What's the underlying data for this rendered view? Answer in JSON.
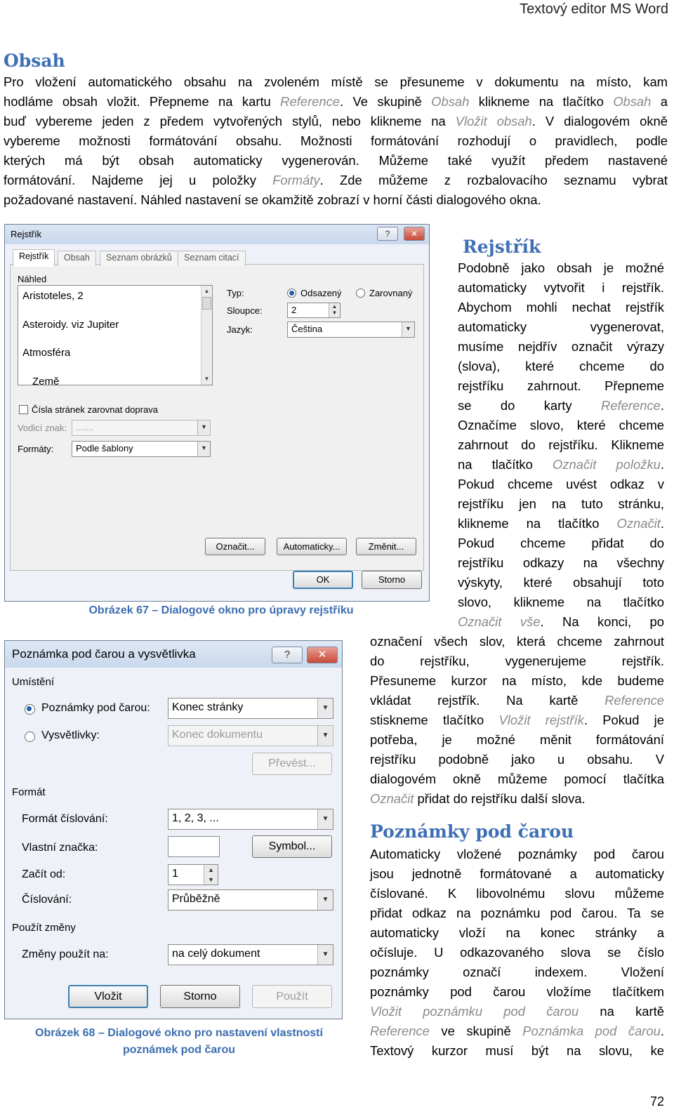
{
  "header": "Textový editor MS Word",
  "page_number": "72",
  "obsah": {
    "heading": "Obsah",
    "lines": [
      [
        {
          "t": "Pro vložení automatického obsahu na zvoleném místě se přesuneme v dokumentu na místo, kam"
        }
      ],
      [
        {
          "t": "hodláme obsah vložit. Přepneme na kartu "
        },
        {
          "t": "Reference",
          "hl": true
        },
        {
          "t": ". Ve skupině "
        },
        {
          "t": "Obsah",
          "hl": true
        },
        {
          "t": " klikneme na tlačítko "
        },
        {
          "t": "Obsah",
          "hl": true
        },
        {
          "t": " a"
        }
      ],
      [
        {
          "t": "buď vybereme jeden z předem vytvořených stylů, nebo klikneme na "
        },
        {
          "t": "Vložit obsah",
          "hl": true
        },
        {
          "t": ". V dialogovém okně"
        }
      ],
      [
        {
          "t": "vybereme možnosti formátování obsahu. Možnosti formátování rozhodují o pravidlech, podle"
        }
      ],
      [
        {
          "t": "kterých má být obsah automaticky vygenerován. Můžeme také využít předem nastavené"
        }
      ],
      [
        {
          "t": "formátování. Najdeme jej u položky "
        },
        {
          "t": "Formáty",
          "hl": true
        },
        {
          "t": ". Zde můžeme z rozbalovacího seznamu vybrat"
        }
      ],
      [
        {
          "t": "požadované nastavení. Náhled nastavení se okamžitě zobrazí v horní části dialogového okna."
        }
      ]
    ]
  },
  "rejstrik": {
    "heading": "Rejstřík",
    "narrow_lines": [
      [
        {
          "t": "Podobně jako obsah je možné"
        }
      ],
      [
        {
          "t": "automaticky vytvořit i rejstřík."
        }
      ],
      [
        {
          "t": "Abychom mohli nechat rejstřík"
        }
      ],
      [
        {
          "t": "automaticky vygenerovat,"
        }
      ],
      [
        {
          "t": "musíme nejdřív označit výrazy"
        }
      ],
      [
        {
          "t": "(slova), které chceme do"
        }
      ],
      [
        {
          "t": "rejstříku zahrnout. Přepneme"
        }
      ],
      [
        {
          "t": "se do karty "
        },
        {
          "t": "Reference",
          "hl": true
        },
        {
          "t": "."
        }
      ],
      [
        {
          "t": "Označíme slovo, které chceme"
        }
      ],
      [
        {
          "t": "zahrnout do rejstříku. Klikneme"
        }
      ],
      [
        {
          "t": "na tlačítko "
        },
        {
          "t": "Označit položku",
          "hl": true
        },
        {
          "t": "."
        }
      ],
      [
        {
          "t": "Pokud chceme uvést odkaz v"
        }
      ],
      [
        {
          "t": "rejstříku jen na tuto stránku,"
        }
      ],
      [
        {
          "t": "klikneme na tlačítko "
        },
        {
          "t": "Označit",
          "hl": true
        },
        {
          "t": "."
        }
      ],
      [
        {
          "t": "Pokud chceme přidat do"
        }
      ],
      [
        {
          "t": "rejstříku odkazy na všechny"
        }
      ],
      [
        {
          "t": "výskyty, které obsahují toto"
        }
      ],
      [
        {
          "t": "slovo, klikneme na tlačítko"
        }
      ],
      [
        {
          "t": "Označit vše",
          "hl": true
        },
        {
          "t": ". Na konci, po"
        }
      ]
    ],
    "wide_lines": [
      [
        {
          "t": "označení všech slov, která chceme zahrnout"
        }
      ],
      [
        {
          "t": "do rejstříku, vygenerujeme rejstřík."
        }
      ],
      [
        {
          "t": "Přesuneme kurzor na místo, kde budeme"
        }
      ],
      [
        {
          "t": "vkládat rejstřík. Na kartě "
        },
        {
          "t": "Reference",
          "hl": true
        }
      ],
      [
        {
          "t": "stiskneme tlačítko "
        },
        {
          "t": "Vložit rejstřík",
          "hl": true
        },
        {
          "t": ". Pokud je"
        }
      ],
      [
        {
          "t": "potřeba, je možné měnit formátování"
        }
      ],
      [
        {
          "t": "rejstříku podobně jako u obsahu. V"
        }
      ],
      [
        {
          "t": "dialogovém okně můžeme pomocí tlačítka"
        }
      ],
      [
        {
          "t": "Označit",
          "hl": true
        },
        {
          "t": " přidat do rejstříku další slova."
        }
      ]
    ]
  },
  "poznamky": {
    "heading": "Poznámky pod čarou",
    "lines": [
      [
        {
          "t": "Automaticky vložené poznámky pod čarou"
        }
      ],
      [
        {
          "t": "jsou jednotně formátované a automaticky"
        }
      ],
      [
        {
          "t": "číslované. K libovolnému slovu můžeme"
        }
      ],
      [
        {
          "t": "přidat odkaz na poznámku pod čarou. Ta se"
        }
      ],
      [
        {
          "t": "automaticky vloží na konec stránky a"
        }
      ],
      [
        {
          "t": "očísluje. U odkazovaného slova se číslo"
        }
      ],
      [
        {
          "t": "poznámky označí indexem. Vložení"
        }
      ],
      [
        {
          "t": "poznámky pod čarou vložíme tlačítkem"
        }
      ],
      [
        {
          "t": "Vložit poznámku pod čarou",
          "hl": true
        },
        {
          "t": " na kartě"
        }
      ],
      [
        {
          "t": "Reference",
          "hl": true
        },
        {
          "t": " ve skupině "
        },
        {
          "t": "Poznámka pod čarou",
          "hl": true
        },
        {
          "t": "."
        }
      ],
      [
        {
          "t": "Textový kurzor musí být na slovu, ke"
        }
      ]
    ]
  },
  "figure67": {
    "caption": "Obrázek 67 – Dialogové okno pro úpravy rejstříku",
    "dialog": {
      "title": "Rejstřík",
      "help": "?",
      "close": "✕",
      "tabs": [
        "Rejstřík",
        "Obsah",
        "Seznam obrázků",
        "Seznam citací"
      ],
      "preview_label": "Náhled",
      "preview_items": [
        "Aristoteles, 2",
        "Asteroidy. viz Jupiter",
        "Atmosféra",
        "Země"
      ],
      "typ_label": "Typ:",
      "typ_option1": "Odsazený",
      "typ_option2": "Zarovnaný",
      "sloupce_label": "Sloupce:",
      "sloupce_value": "2",
      "jazyk_label": "Jazyk:",
      "jazyk_value": "Čeština",
      "cisla_label": "Čísla stránek zarovnat doprava",
      "vodici_label": "Vodicí znak:",
      "vodici_value": ".......",
      "formaty_label": "Formáty:",
      "formaty_value": "Podle šablony",
      "oznacit_btn": "Označit...",
      "automaticky_btn": "Automaticky...",
      "zmenit_btn": "Změnit...",
      "ok_btn": "OK",
      "storno_btn": "Storno"
    }
  },
  "figure68": {
    "caption_lines": [
      "Obrázek 68 – Dialogové okno pro nastavení vlastností",
      "poznámek pod čarou"
    ],
    "dialog": {
      "title": "Poznámka pod čarou a vysvětlivka",
      "help": "?",
      "close": "✕",
      "umisteni": "Umístění",
      "poznamky_label": "Poznámky pod čarou:",
      "poznamky_value": "Konec stránky",
      "vysvetlivky_label": "Vysvětlivky:",
      "vysvetlivky_value": "Konec dokumentu",
      "prevest_btn": "Převést...",
      "format": "Formát",
      "format_cislovani_label": "Formát číslování:",
      "format_cislovani_value": "1, 2, 3, ...",
      "vlastni_znacka_label": "Vlastní značka:",
      "vlastni_znacka_value": "",
      "symbol_btn": "Symbol...",
      "zacit_od_label": "Začít od:",
      "zacit_od_value": "1",
      "cislovani_label": "Číslování:",
      "cislovani_value": "Průběžně",
      "pouzit_zmeny": "Použít změny",
      "zmeny_label": "Změny použít na:",
      "zmeny_value": "na celý dokument",
      "vlozit_btn": "Vložit",
      "storno_btn": "Storno",
      "pouzit_btn": "Použít"
    }
  }
}
